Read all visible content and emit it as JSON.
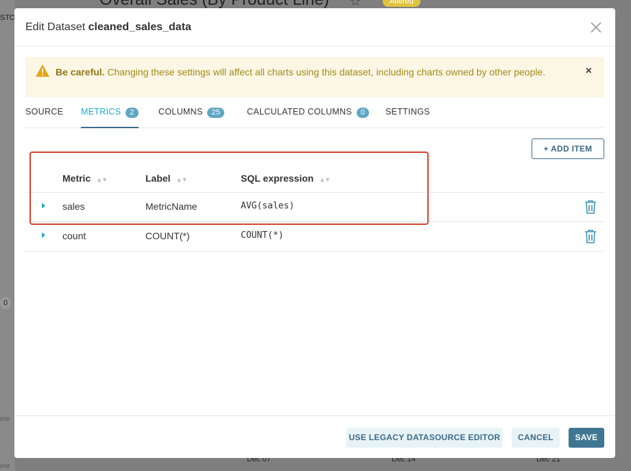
{
  "background": {
    "page_title": "Overall Sales (By Product Line)",
    "altered_badge": "Altered",
    "side_fragment": "STO",
    "badge_zero": "0",
    "placeholder_fragment_1": "ere",
    "placeholder_fragment_2": "ere",
    "x_ticks": [
      "Dec 07",
      "Dec 14",
      "Dec 21"
    ]
  },
  "modal": {
    "title_prefix": "Edit Dataset ",
    "dataset_name": "cleaned_sales_data",
    "close_icon": "close-icon"
  },
  "alert": {
    "bold": "Be careful.",
    "message": " Changing these settings will affect all charts using this dataset, including charts owned by other people.",
    "icon": "warning-icon",
    "close_label": "×"
  },
  "tabs": [
    {
      "label": "SOURCE",
      "badge": ""
    },
    {
      "label": "METRICS",
      "badge": "2"
    },
    {
      "label": "COLUMNS",
      "badge": "25"
    },
    {
      "label": "CALCULATED COLUMNS",
      "badge": "0"
    },
    {
      "label": "SETTINGS",
      "badge": ""
    }
  ],
  "active_tab": "METRICS",
  "add_item_label": "ADD ITEM",
  "table": {
    "headers": [
      "Metric",
      "Label",
      "SQL expression"
    ],
    "rows": [
      {
        "metric": "sales",
        "label": "MetricName",
        "sql": "AVG(sales)"
      },
      {
        "metric": "count",
        "label": "COUNT(*)",
        "sql": "COUNT(*)"
      }
    ]
  },
  "footer": {
    "legacy_label": "USE LEGACY DATASOURCE EDITOR",
    "cancel_label": "CANCEL",
    "save_label": "SAVE"
  },
  "colors": {
    "accent": "#20a7c9",
    "primary_dark": "#3f7792",
    "warning_bg": "#fcf6e4",
    "highlight_box": "#d5432c"
  }
}
